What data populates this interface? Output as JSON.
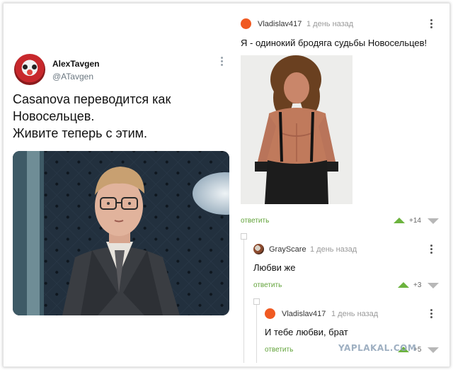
{
  "tweet": {
    "name": "AlexTavgen",
    "handle": "@ATavgen",
    "lines": [
      "Casanova переводится как",
      "Новосельцев.",
      "Живите теперь с этим."
    ]
  },
  "comments": [
    {
      "author": "Vladislav417",
      "time": "1 день назад",
      "text": "Я - одинокий бродяга судьбы Новосельцев!",
      "reply_label": "ответить",
      "score": "+14"
    },
    {
      "author": "GrayScare",
      "time": "1 день назад",
      "text": "Любви же",
      "reply_label": "ответить",
      "score": "+3"
    },
    {
      "author": "Vladislav417",
      "time": "1 день назад",
      "text": "И тебе любви, брат",
      "reply_label": "ответить",
      "score": "+5"
    }
  ],
  "watermark": "YAPLAKAL.COM",
  "colors": {
    "accent_orange": "#f05a22",
    "reply_green": "#62a33a",
    "upvote_green": "#6cb33e",
    "downvote_gray": "#b7b7b7"
  },
  "icons": [
    "clown-avatar",
    "more-vertical-icon",
    "upvote-icon",
    "downvote-icon",
    "user-avatar-icon"
  ]
}
